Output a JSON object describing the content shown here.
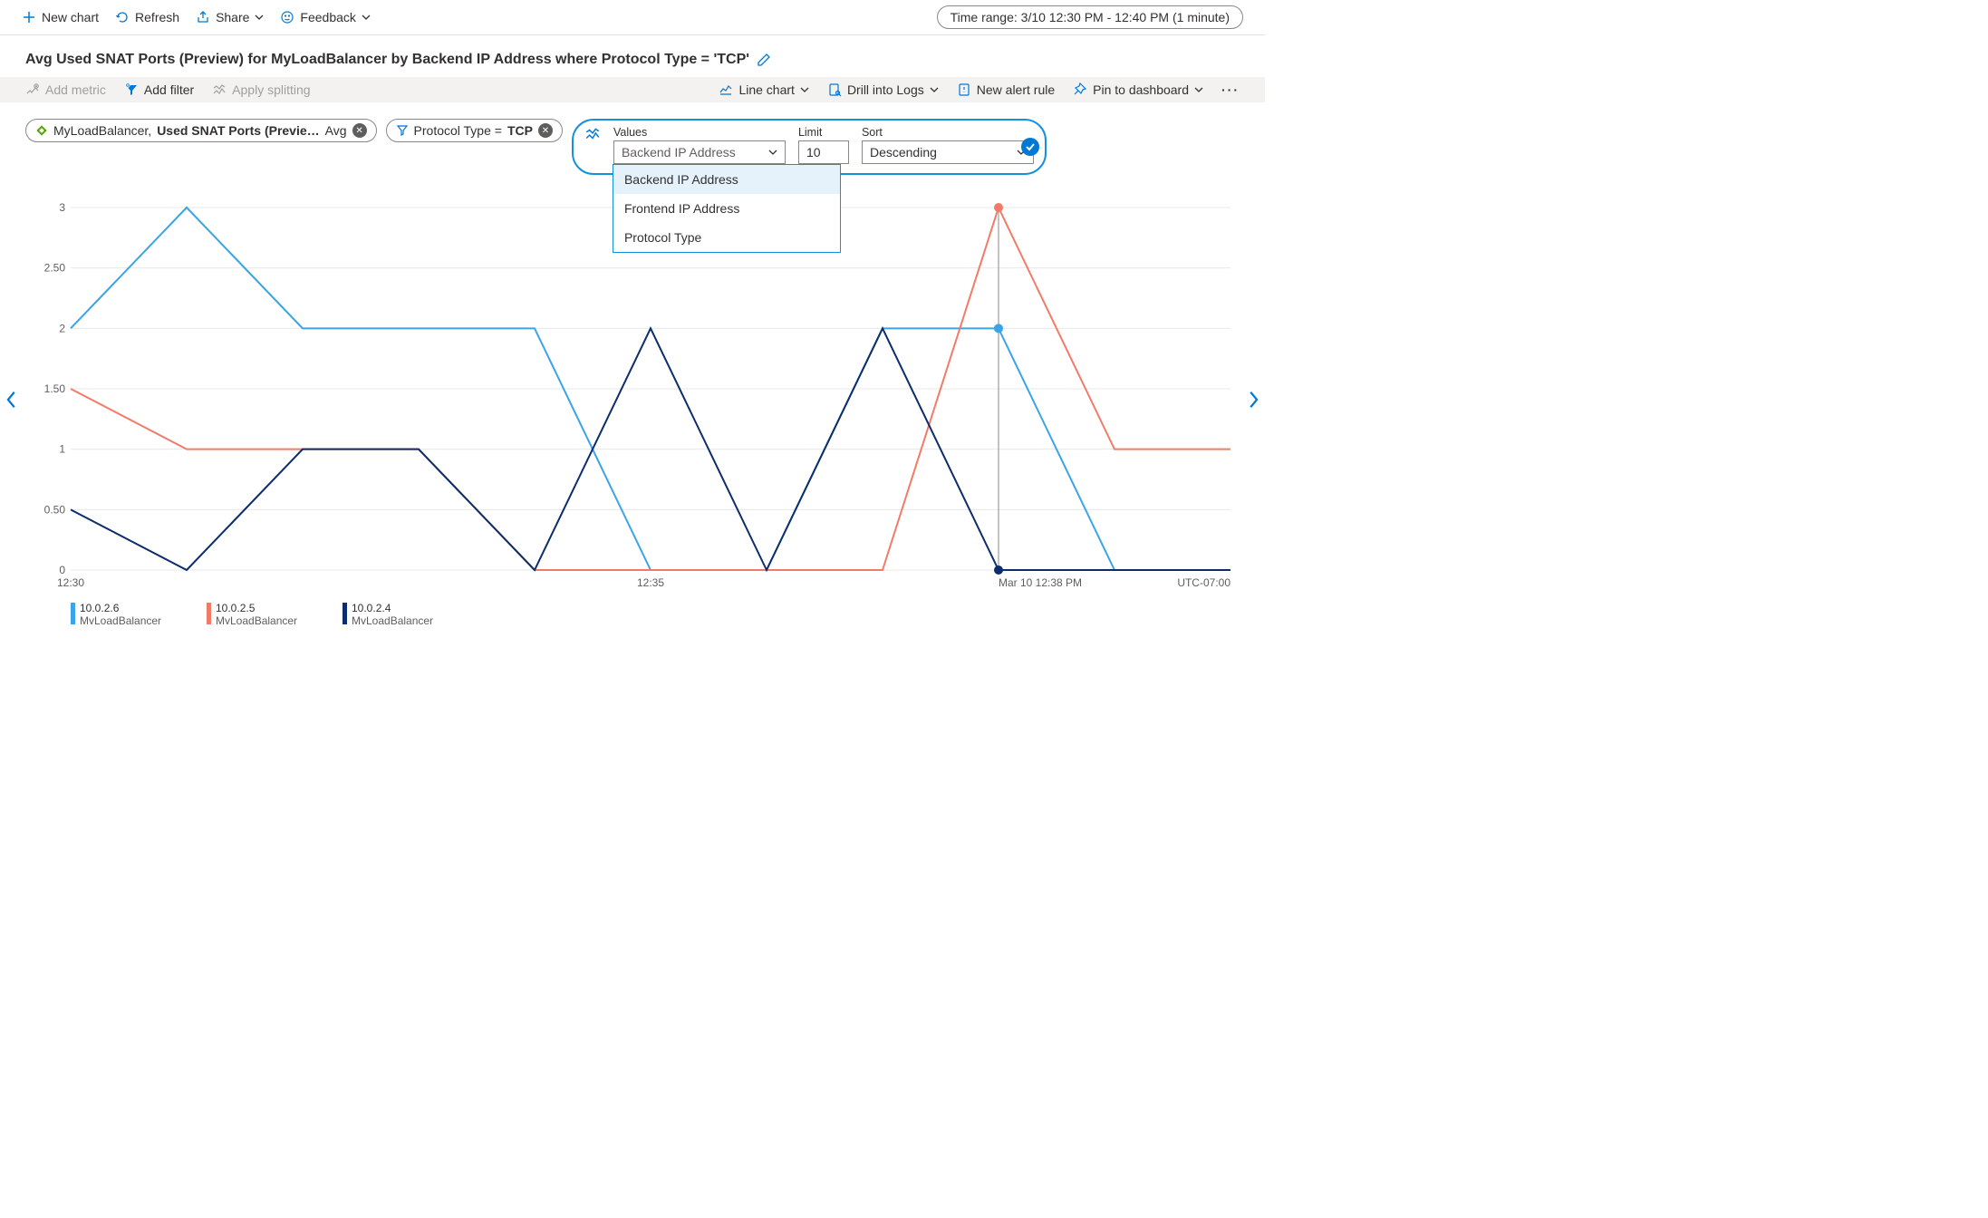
{
  "toolbar": {
    "new_chart": "New chart",
    "refresh": "Refresh",
    "share": "Share",
    "feedback": "Feedback",
    "time_range": "Time range: 3/10 12:30 PM - 12:40 PM (1 minute)"
  },
  "title": "Avg Used SNAT Ports (Preview) for MyLoadBalancer by Backend IP Address where Protocol Type = 'TCP'",
  "toolrow": {
    "add_metric": "Add metric",
    "add_filter": "Add filter",
    "apply_splitting": "Apply splitting",
    "line_chart": "Line chart",
    "drill_logs": "Drill into Logs",
    "new_alert": "New alert rule",
    "pin_dashboard": "Pin to dashboard"
  },
  "pills": {
    "metric_resource": "MyLoadBalancer,",
    "metric_name": "Used SNAT Ports (Previe…",
    "metric_agg": "Avg",
    "filter_text": "Protocol Type  =  ",
    "filter_value": "TCP"
  },
  "split": {
    "values_label": "Values",
    "values_selected": "Backend IP Address",
    "limit_label": "Limit",
    "limit_value": "10",
    "sort_label": "Sort",
    "sort_value": "Descending",
    "options": [
      "Backend IP Address",
      "Frontend IP Address",
      "Protocol Type"
    ]
  },
  "chart_data": {
    "type": "line",
    "title": "",
    "xlabel": "",
    "ylabel": "",
    "ylim": [
      0,
      3
    ],
    "yticks": [
      0,
      0.5,
      1,
      1.5,
      2,
      2.5,
      3
    ],
    "yticklabels": [
      "0",
      "0.50",
      "1",
      "1.50",
      "2",
      "2.50",
      "3"
    ],
    "x": [
      0,
      1,
      2,
      3,
      4,
      5,
      6,
      7,
      8,
      9,
      10
    ],
    "xticks": [
      0,
      5,
      8
    ],
    "xticklabels": [
      "12:30",
      "12:35",
      "Mar 10 12:38 PM"
    ],
    "utc": "UTC-07:00",
    "cursor_x": 8,
    "series": [
      {
        "name": "10.0.2.6",
        "resource": "MyLoadBalancer",
        "color": "#3aa4e8",
        "values": [
          2,
          3,
          2,
          2,
          2,
          0,
          0,
          2,
          2,
          0,
          0
        ],
        "current": 2
      },
      {
        "name": "10.0.2.5",
        "resource": "MyLoadBalancer",
        "color": "#f27b68",
        "values": [
          1.5,
          1,
          1,
          1,
          0,
          0,
          0,
          0,
          3,
          1,
          1
        ],
        "current": 3
      },
      {
        "name": "10.0.2.4",
        "resource": "MyLoadBalancer",
        "color": "#0b2d6b",
        "values": [
          0.5,
          0,
          1,
          1,
          0,
          2,
          0,
          2,
          0,
          0,
          0
        ],
        "current": 0
      }
    ]
  }
}
